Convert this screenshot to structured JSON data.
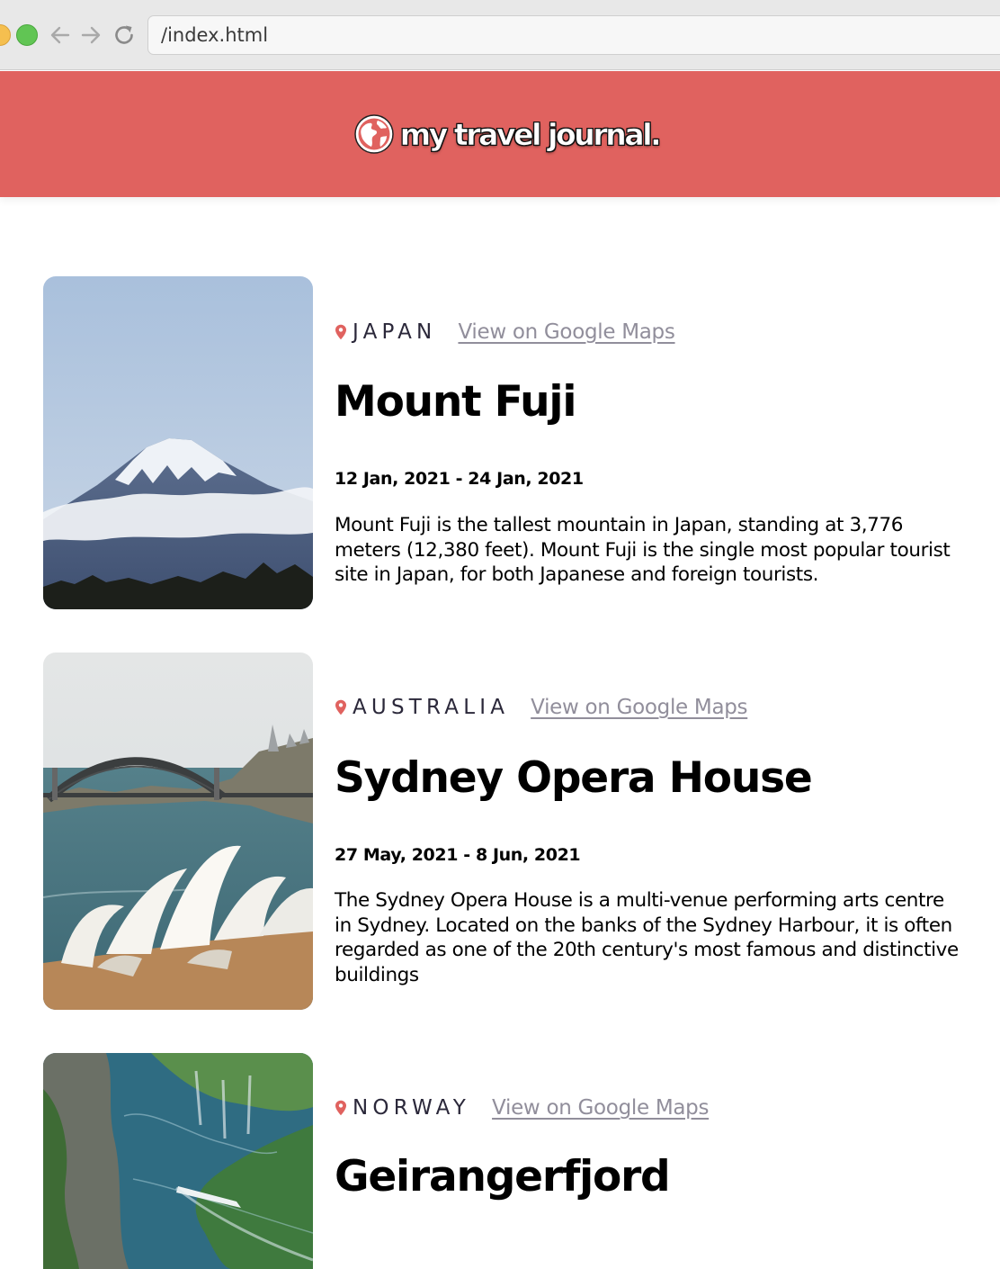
{
  "browser": {
    "url": "/index.html"
  },
  "header": {
    "brand": "my travel journal."
  },
  "entries": [
    {
      "country": "JAPAN",
      "maps_link": "View on Google Maps",
      "title": "Mount Fuji",
      "dates": "12 Jan, 2021 - 24 Jan, 2021",
      "description": "Mount Fuji is the tallest mountain in Japan, standing at 3,776 meters (12,380 feet). Mount Fuji is the single most popular tourist site in Japan, for both Japanese and foreign tourists."
    },
    {
      "country": "AUSTRALIA",
      "maps_link": "View on Google Maps",
      "title": "Sydney Opera House",
      "dates": "27 May, 2021 - 8 Jun, 2021",
      "description": "The Sydney Opera House is a multi-venue performing arts centre in Sydney. Located on the banks of the Sydney Harbour, it is often regarded as one of the 20th century's most famous and distinctive buildings"
    },
    {
      "country": "NORWAY",
      "maps_link": "View on Google Maps",
      "title": "Geirangerfjord",
      "dates": "",
      "description": ""
    }
  ],
  "colors": {
    "header_bg": "#e0625f",
    "pin": "#e0625f",
    "link": "#918e9b",
    "country_text": "#2b283a"
  },
  "icons": {
    "brand": "globe-icon",
    "location": "location-pin-icon",
    "back": "arrow-left-icon",
    "forward": "arrow-right-icon",
    "reload": "reload-icon"
  }
}
